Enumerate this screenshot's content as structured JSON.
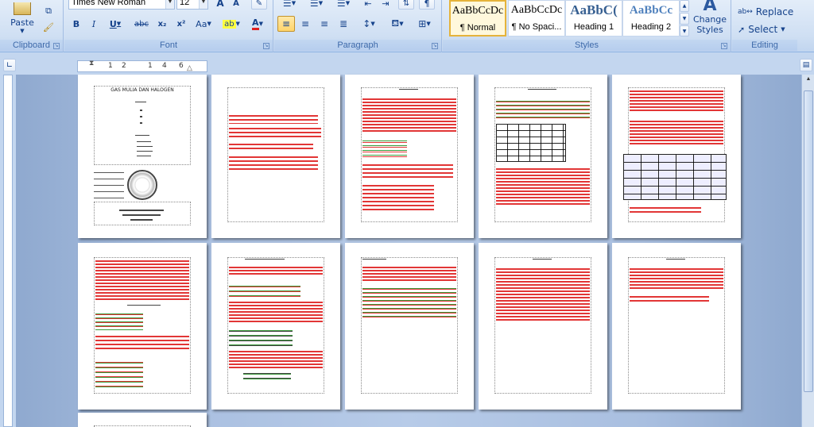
{
  "ribbon": {
    "clipboard": {
      "label": "Clipboard",
      "paste_label": "Paste"
    },
    "font": {
      "label": "Font",
      "font_name": "Times New Roman",
      "font_size": "12"
    },
    "paragraph": {
      "label": "Paragraph"
    },
    "styles": {
      "label": "Styles",
      "tiles": [
        {
          "sample": "AaBbCcDc",
          "name": "¶ Normal"
        },
        {
          "sample": "AaBbCcDc",
          "name": "¶ No Spaci..."
        },
        {
          "sample": "AaBbC(",
          "name": "Heading 1"
        },
        {
          "sample": "AaBbCc",
          "name": "Heading 2"
        }
      ],
      "change_styles_label": "Change Styles"
    },
    "editing": {
      "label": "Editing",
      "replace_label": "Replace",
      "select_label": "Select"
    }
  },
  "ruler": {
    "ticks": [
      "1",
      "2",
      "1",
      "4",
      "6"
    ]
  },
  "document": {
    "cover_title": "GAS MULIA DAN HALOGEN"
  },
  "colors": {
    "ribbon": "#cfdff3",
    "canvas": "#a9bfe0",
    "text_red": "#e23636",
    "text_green": "#3a9a3a",
    "highlight": "#ffd46a"
  }
}
